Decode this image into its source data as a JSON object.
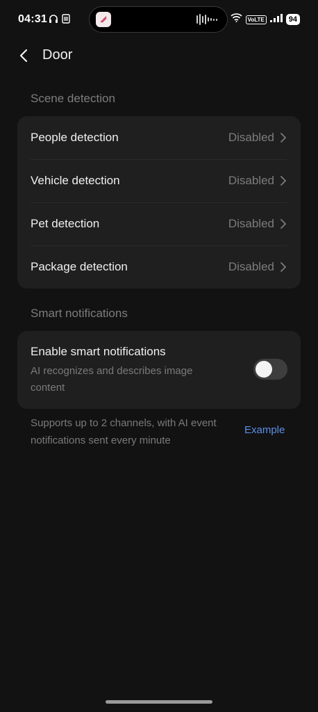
{
  "status_bar": {
    "time": "04:31",
    "left_icons": [
      "headphones-icon",
      "sim-card-icon"
    ],
    "right_icons": [
      "wifi-icon",
      "volte-badge",
      "signal-icon",
      "battery-icon"
    ],
    "volte_label": "VoLTE",
    "battery_level": "94"
  },
  "header": {
    "title": "Door"
  },
  "scene_detection": {
    "section_title": "Scene detection",
    "items": [
      {
        "label": "People detection",
        "value": "Disabled"
      },
      {
        "label": "Vehicle detection",
        "value": "Disabled"
      },
      {
        "label": "Pet detection",
        "value": "Disabled"
      },
      {
        "label": "Package detection",
        "value": "Disabled"
      }
    ]
  },
  "smart_notifications": {
    "section_title": "Smart notifications",
    "toggle_title": "Enable smart notifications",
    "toggle_description": "AI recognizes and describes image content",
    "enabled": false,
    "footnote": "Supports up to 2 channels, with AI event notifications sent every minute",
    "example_link": "Example"
  },
  "colors": {
    "background": "#121212",
    "card": "#1f1f1f",
    "link": "#5b8ee8",
    "secondary_text": "#7c7c7c"
  }
}
